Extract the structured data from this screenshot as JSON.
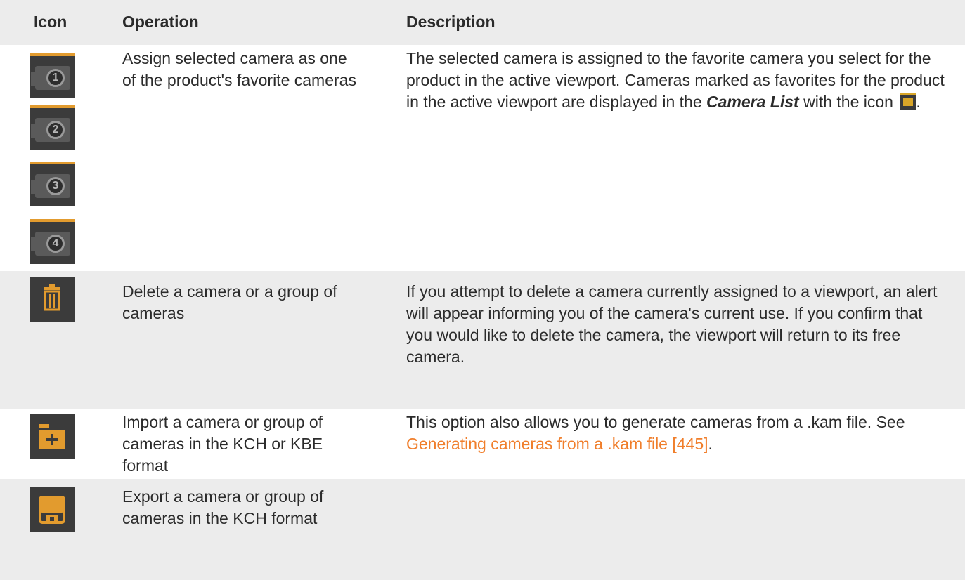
{
  "header": {
    "icon": "Icon",
    "operation": "Operation",
    "description": "Description"
  },
  "rows": [
    {
      "icons": [
        "favorite-camera-1-icon",
        "favorite-camera-2-icon",
        "favorite-camera-3-icon",
        "favorite-camera-4-icon"
      ],
      "icon_numbers": [
        "1",
        "2",
        "3",
        "4"
      ],
      "operation": "Assign selected camera as one of the product's favorite cameras",
      "description_prefix": "The selected camera is assigned to the favorite camera you select for the product in the active viewport. Cameras marked as favorites for the product in the active viewport are displayed in the ",
      "description_emph": "Camera List",
      "description_suffix": " with the icon",
      "description_end": "."
    },
    {
      "icon": "trash-icon",
      "operation": "Delete a camera or a group of cameras",
      "description": "If you attempt to delete a camera currently assigned to a viewport, an alert will appear informing you of the camera's current use. If you confirm that you would like to delete the camera, the viewport will return to its free camera."
    },
    {
      "icon": "import-folder-icon",
      "operation": "Import a camera or group of cameras in the KCH or KBE format",
      "description_prefix": "This option also allows you to generate cameras from a .kam file. See ",
      "description_link": "Generating cameras from a .kam file [445]",
      "description_suffix": "."
    },
    {
      "icon": "export-save-icon",
      "operation": "Export a camera or group of cameras in the KCH format",
      "description": ""
    }
  ],
  "colors": {
    "header_bg": "#ececec",
    "accent": "#e29b2e",
    "link": "#f07e2b",
    "icon_bg": "#3b3b3b"
  }
}
